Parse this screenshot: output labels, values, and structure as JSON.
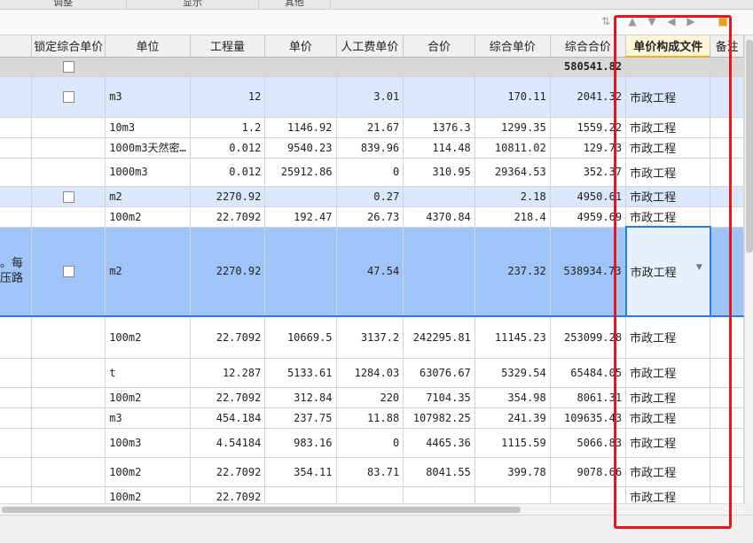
{
  "top_tabs": [
    "调整",
    "显示",
    "其他"
  ],
  "columns": [
    "锁定综合单价",
    "单位",
    "工程量",
    "单价",
    "人工费单价",
    "合价",
    "综合单价",
    "综合合价",
    "单价构成文件",
    "备注"
  ],
  "summary": {
    "total": "580541.82"
  },
  "rows": [
    {
      "desc": "",
      "unit": "m3",
      "qty": "12",
      "price": "",
      "labor": "3.01",
      "total": "",
      "comp_price": "170.11",
      "comp_total": "2041.32",
      "file": "市政工程"
    },
    {
      "desc": "",
      "unit": "10m3",
      "qty": "1.2",
      "price": "1146.92",
      "labor": "21.67",
      "total": "1376.3",
      "comp_price": "1299.35",
      "comp_total": "1559.22",
      "file": "市政工程"
    },
    {
      "desc": "",
      "unit": "1000m3天然密…",
      "qty": "0.012",
      "price": "9540.23",
      "labor": "839.96",
      "total": "114.48",
      "comp_price": "10811.02",
      "comp_total": "129.73",
      "file": "市政工程"
    },
    {
      "desc": "",
      "unit": "1000m3",
      "qty": "0.012",
      "price": "25912.86",
      "labor": "0",
      "total": "310.95",
      "comp_price": "29364.53",
      "comp_total": "352.37",
      "file": "市政工程"
    },
    {
      "desc": "",
      "unit": "m2",
      "qty": "2270.92",
      "price": "",
      "labor": "0.27",
      "total": "",
      "comp_price": "2.18",
      "comp_total": "4950.61",
      "file": "市政工程"
    },
    {
      "desc": "",
      "unit": "100m2",
      "qty": "22.7092",
      "price": "192.47",
      "labor": "26.73",
      "total": "4370.84",
      "comp_price": "218.4",
      "comp_total": "4959.69",
      "file": "市政工程"
    },
    {
      "desc": "。每\n压路",
      "unit": "m2",
      "qty": "2270.92",
      "price": "",
      "labor": "47.54",
      "total": "",
      "comp_price": "237.32",
      "comp_total": "538934.73",
      "file": "市政工程"
    },
    {
      "desc": "",
      "unit": "100m2",
      "qty": "22.7092",
      "price": "10669.5",
      "labor": "3137.2",
      "total": "242295.81",
      "comp_price": "11145.23",
      "comp_total": "253099.28",
      "file": "市政工程"
    },
    {
      "desc": "",
      "unit": "t",
      "qty": "12.287",
      "price": "5133.61",
      "labor": "1284.03",
      "total": "63076.67",
      "comp_price": "5329.54",
      "comp_total": "65484.05",
      "file": "市政工程"
    },
    {
      "desc": "",
      "unit": "100m2",
      "qty": "22.7092",
      "price": "312.84",
      "labor": "220",
      "total": "7104.35",
      "comp_price": "354.98",
      "comp_total": "8061.31",
      "file": "市政工程"
    },
    {
      "desc": "",
      "unit": "m3",
      "qty": "454.184",
      "price": "237.75",
      "labor": "11.88",
      "total": "107982.25",
      "comp_price": "241.39",
      "comp_total": "109635.43",
      "file": "市政工程"
    },
    {
      "desc": "",
      "unit": "100m3",
      "qty": "4.54184",
      "price": "983.16",
      "labor": "0",
      "total": "4465.36",
      "comp_price": "1115.59",
      "comp_total": "5066.83",
      "file": "市政工程"
    },
    {
      "desc": "",
      "unit": "100m2",
      "qty": "22.7092",
      "price": "354.11",
      "labor": "83.71",
      "total": "8041.55",
      "comp_price": "399.78",
      "comp_total": "9078.66",
      "file": "市政工程"
    },
    {
      "desc": "",
      "unit": "100m2",
      "qty": "22.7092",
      "price": "",
      "labor": "",
      "total": "",
      "comp_price": "",
      "comp_total": "",
      "file": "市政工程"
    }
  ],
  "colors": {
    "highlight_box": "#e8161a",
    "selected_row": "#9fc5f8",
    "group_row": "#dbe8fb",
    "header_highlight": "#fff6d8"
  }
}
